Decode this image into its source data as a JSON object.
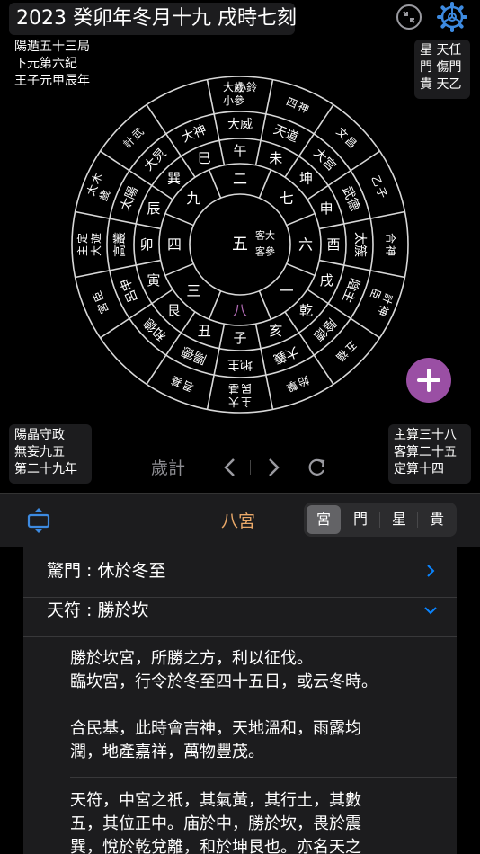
{
  "header": {
    "title": "2023 癸卯年冬月十九 戌時七刻",
    "top_left_lines": [
      "陽遁五十三局",
      "下元第六紀",
      "王子元甲辰年"
    ],
    "top_right_lines": [
      "星 天任",
      "門 傷門",
      "貴 天乙"
    ]
  },
  "wheel": {
    "center": "五",
    "center_side": [
      "客大",
      "客參"
    ],
    "inner_ring": [
      {
        "text": "二"
      },
      {
        "text": "七"
      },
      {
        "text": "六"
      },
      {
        "text": "一"
      },
      {
        "text": "八",
        "highlight": true
      },
      {
        "text": "三"
      },
      {
        "text": "四"
      },
      {
        "text": "九"
      }
    ],
    "branch_ring": [
      "午",
      "未",
      "申",
      "申",
      "酉",
      "戌",
      "亥",
      "子",
      "丑",
      "艮",
      "寅",
      "卯",
      "辰",
      "巽",
      "巳",
      "午"
    ],
    "branch_ring_display": [
      "午",
      "未",
      "坤",
      "申",
      "酉",
      "戌",
      "乾",
      "亥",
      "子",
      "丑",
      "艮",
      "寅",
      "卯",
      "辰",
      "巽",
      "巳"
    ],
    "deity_ring": [
      "大威",
      "天道",
      "大宫",
      "武德",
      "太簇",
      "陰主",
      "陰德",
      "大義",
      "地主",
      "陽德",
      "和德",
      "呂申",
      "高叢",
      "太陽",
      "大炅",
      "大神"
    ],
    "outer_ring": [
      [
        "大歲",
        "小鈴",
        "小參"
      ],
      [
        "四",
        "神"
      ],
      [
        "文",
        "昌"
      ],
      [
        "乙",
        "子"
      ],
      [
        "合",
        "神"
      ],
      [
        "計",
        "神",
        "臣"
      ],
      [
        "五",
        "福"
      ],
      [
        "始",
        "擊"
      ],
      [
        "主",
        "大",
        "民",
        "基"
      ],
      [
        "君",
        "基"
      ],
      [
        ""
      ],
      [
        "宮",
        "臣"
      ],
      [
        "主",
        "定",
        "大",
        "遊"
      ],
      [
        "太",
        "木",
        "歲"
      ],
      [
        "計",
        "武"
      ],
      [
        ""
      ]
    ]
  },
  "bottom_left_lines": [
    "陽晶守政",
    "無妄九五",
    "第二十九年"
  ],
  "bottom_right_lines": [
    "主算三十八",
    "客算二十五",
    "定算十四"
  ],
  "nav": {
    "mode_label": "歲計"
  },
  "toolbar": {
    "palace_title": "八宮",
    "segments": [
      "宮",
      "門",
      "星",
      "貴"
    ],
    "selected_segment": "宮"
  },
  "details": {
    "rows": [
      {
        "label": "驚門 : 休於冬至",
        "state": "collapsed"
      },
      {
        "label": "天符 : 勝於坎",
        "state": "expanded"
      }
    ],
    "paragraphs": [
      [
        "勝於坎宮，所勝之方，利以征伐。",
        "臨坎宮，行令於冬至四十五日，或云冬時。"
      ],
      [
        "合民基，此時會吉神，天地溫和，雨露均",
        "潤，地產嘉祥，萬物豐茂。"
      ],
      [
        "天符，中宮之祇，其氣黃，其行土，其數",
        "五，其位正中。庙於中，勝於坎，畏於震",
        "巽，悅於乾兌離，和於坤艮也。亦名天之"
      ]
    ]
  },
  "colors": {
    "accent_purple": "#9a4fa4",
    "palace_title": "#e9a869",
    "chevron_blue": "#0a84ff",
    "highlight": "#b06ab3"
  }
}
